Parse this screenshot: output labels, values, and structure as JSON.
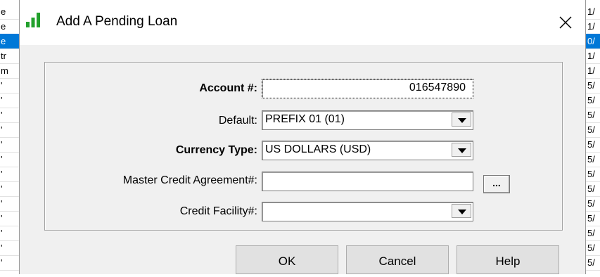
{
  "dialog": {
    "title": "Add A Pending Loan",
    "close_glyph": "✕"
  },
  "form": {
    "account": {
      "label": "Account #:",
      "value": "016547890"
    },
    "default": {
      "label": "Default:",
      "value": "PREFIX 01 (01)"
    },
    "currency": {
      "label": "Currency Type:",
      "value": "US DOLLARS (USD)"
    },
    "master_credit": {
      "label": "Master Credit Agreement#:",
      "value": "",
      "browse_label": "..."
    },
    "credit_facility": {
      "label": "Credit Facility#:",
      "value": ""
    }
  },
  "buttons": {
    "ok": "OK",
    "cancel": "Cancel",
    "help": "Help"
  },
  "background_left": [
    "e",
    "e",
    "e",
    "tr",
    "m",
    "'",
    "'",
    "'",
    "'",
    "'",
    "'",
    "'",
    "'",
    "'",
    "'",
    "'",
    "'",
    "'"
  ],
  "background_right": [
    "1/",
    "1/",
    "0/",
    "1/",
    "1/",
    "5/",
    "5/",
    "5/",
    "5/",
    "5/",
    "5/",
    "5/",
    "5/",
    "5/",
    "5/",
    "5/",
    "5/",
    "5/"
  ],
  "colors": {
    "selection": "#0078d7",
    "icon_green": "#22a02c"
  }
}
